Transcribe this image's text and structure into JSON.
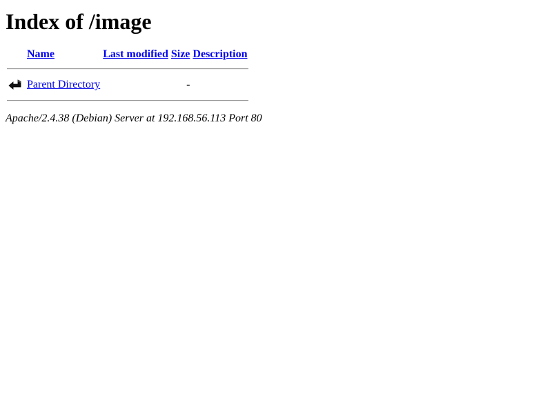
{
  "page": {
    "title": "Index of /image"
  },
  "table": {
    "headers": {
      "name": "Name",
      "last_modified": "Last modified",
      "size": "Size",
      "description": "Description"
    },
    "rows": [
      {
        "icon": "back-arrow-icon",
        "name": "Parent Directory",
        "last_modified": "",
        "size": "-",
        "description": ""
      }
    ]
  },
  "footer": {
    "server_signature": "Apache/2.4.38 (Debian) Server at 192.168.56.113 Port 80"
  }
}
